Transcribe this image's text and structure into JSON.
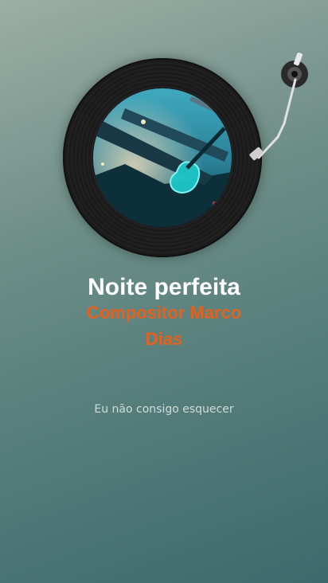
{
  "player": {
    "title": "Noite perfeita",
    "artist": "Compositor Marco Dias",
    "lyric_line": "Eu não consigo esquecer"
  },
  "icons": {
    "record": "vinyl-record-icon",
    "tonearm": "tonearm-icon"
  },
  "colors": {
    "title": "#ffffff",
    "artist": "#e4611e",
    "lyric": "#cfdcd8",
    "background_top": "#9bafa5",
    "background_bottom": "#3c6a6c"
  }
}
